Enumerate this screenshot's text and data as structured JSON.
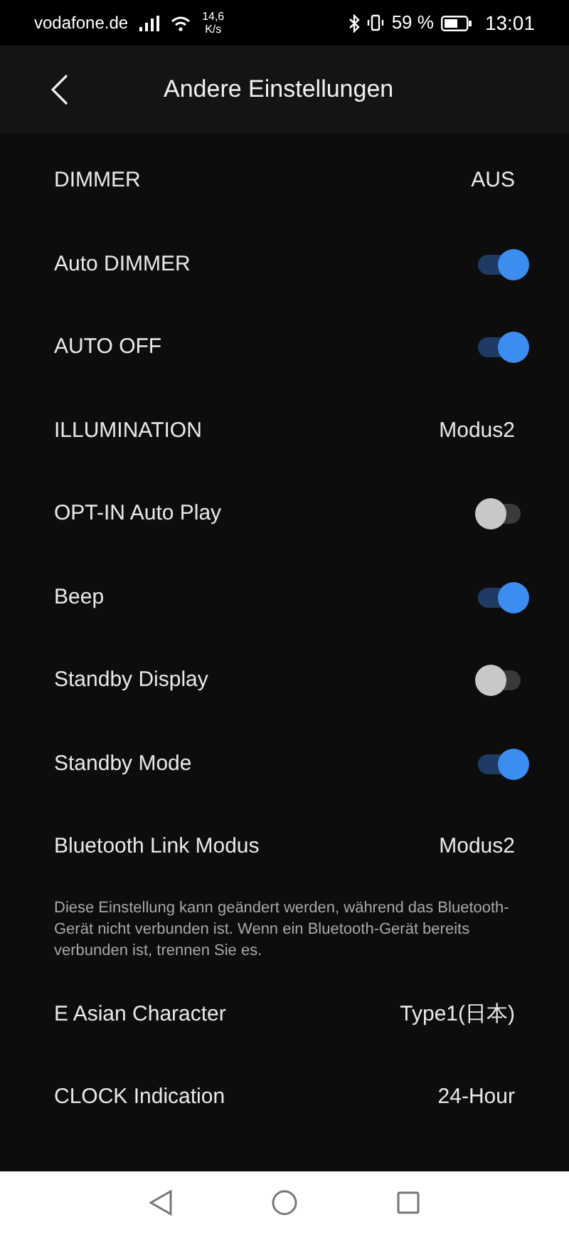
{
  "status_bar": {
    "carrier": "vodafone.de",
    "speed_value": "14,6",
    "speed_unit": "K/s",
    "battery_percent": "59 %",
    "time": "13:01"
  },
  "header": {
    "title": "Andere Einstellungen"
  },
  "settings": [
    {
      "kind": "value",
      "label": "DIMMER",
      "value": "AUS"
    },
    {
      "kind": "toggle",
      "label": "Auto DIMMER",
      "on": true
    },
    {
      "kind": "toggle",
      "label": "AUTO OFF",
      "on": true
    },
    {
      "kind": "value",
      "label": "ILLUMINATION",
      "value": "Modus2"
    },
    {
      "kind": "toggle",
      "label": "OPT-IN Auto Play",
      "on": false
    },
    {
      "kind": "toggle",
      "label": "Beep",
      "on": true
    },
    {
      "kind": "toggle",
      "label": "Standby Display",
      "on": false
    },
    {
      "kind": "toggle",
      "label": "Standby Mode",
      "on": true
    },
    {
      "kind": "value",
      "label": "Bluetooth Link Modus",
      "value": "Modus2"
    },
    {
      "kind": "note",
      "text": "Diese Einstellung kann geändert werden, während das Bluetooth-Gerät nicht verbunden ist. Wenn ein Bluetooth-Gerät bereits verbunden ist, trennen Sie es."
    },
    {
      "kind": "value",
      "label": "E Asian Character",
      "value": "Type1(日本)"
    },
    {
      "kind": "value",
      "label": "CLOCK Indication",
      "value": "24-Hour"
    }
  ]
}
